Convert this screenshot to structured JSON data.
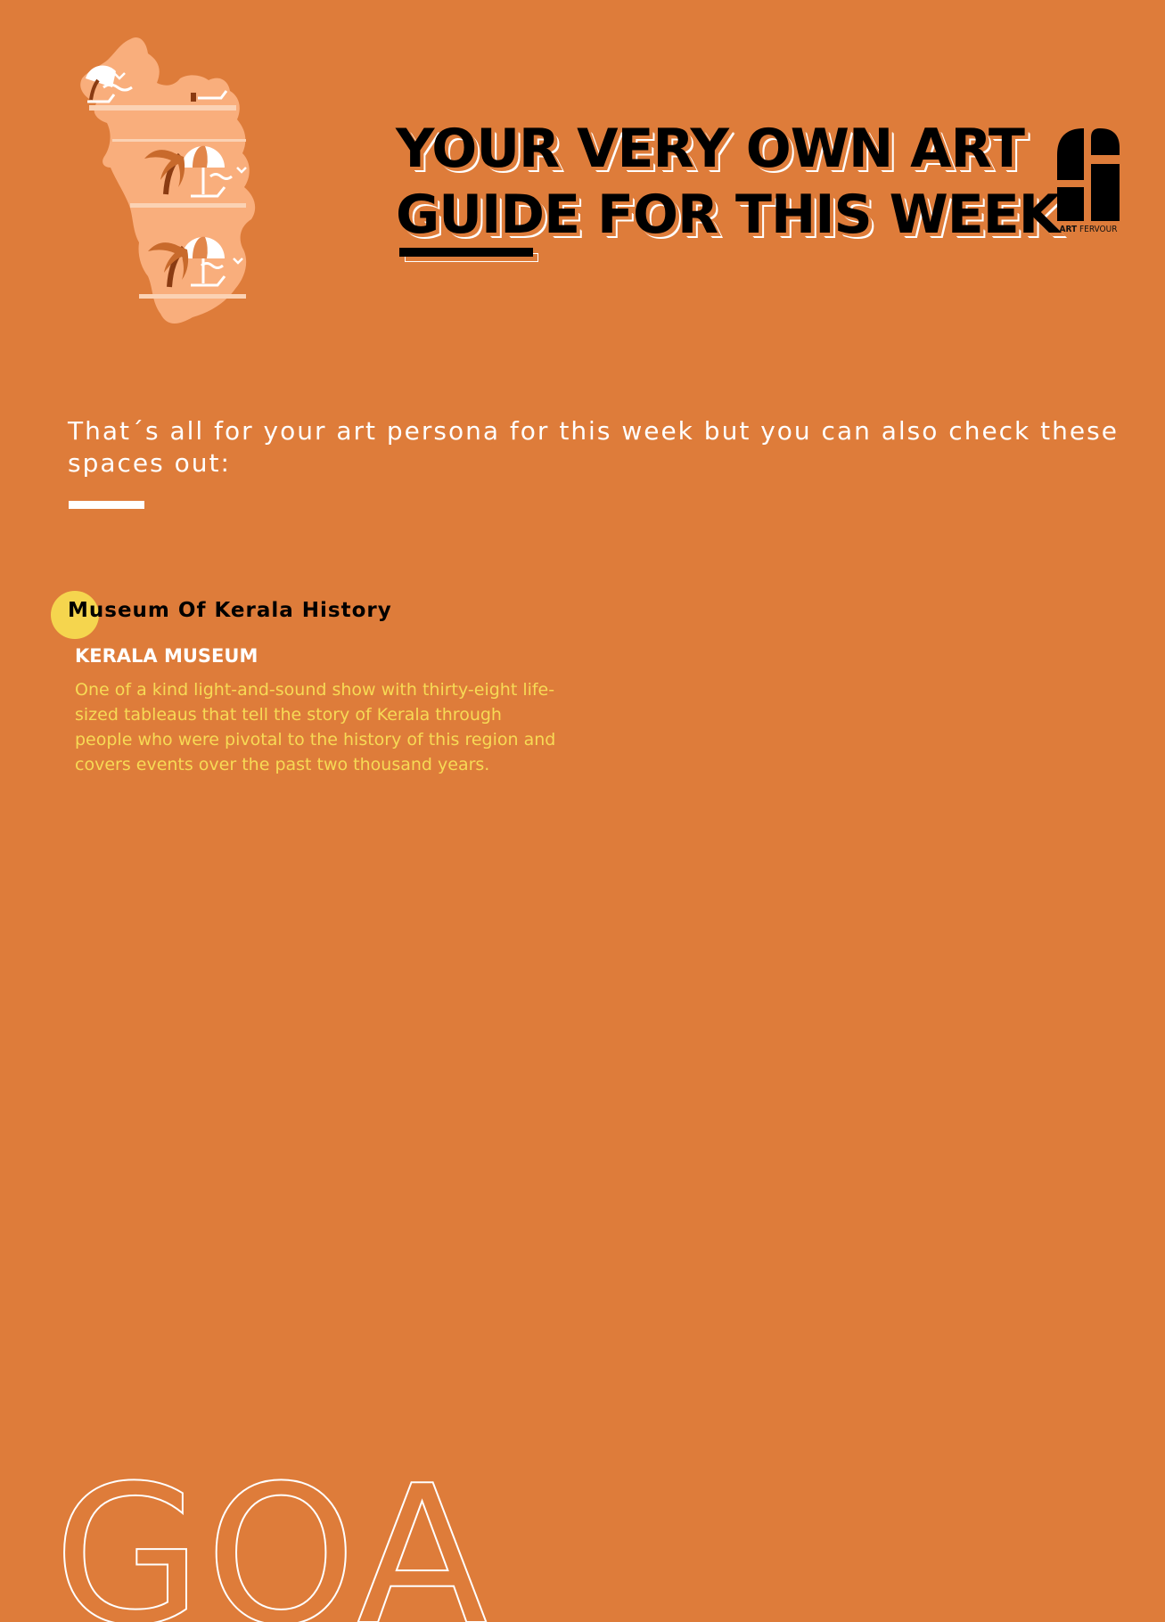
{
  "colors": {
    "background": "#de7c3a",
    "accent_yellow": "#f5d54e",
    "description_text": "#f7da55",
    "map_fill": "#f9ae7c"
  },
  "headline": {
    "line1": "YOUR VERY OWN ART",
    "line2": "GUIDE FOR THIS WEEK"
  },
  "brand": {
    "name_bold": "ART",
    "name_regular": "FERVOUR"
  },
  "intro": {
    "text": "That´s all for your art persona for this week but you can also check these spaces out:"
  },
  "venue": {
    "title": "Museum Of Kerala History",
    "location": "KERALA MUSEUM",
    "description": "One of a kind light-and-sound show with thirty-eight life-sized tableaus that tell the story of Kerala through people who were pivotal to the history of this region and covers events over the past two thousand years."
  },
  "footer": {
    "region_word": "GOA"
  },
  "icons": {
    "map": "goa-map-illustration",
    "logo": "art-fervour-logo"
  }
}
